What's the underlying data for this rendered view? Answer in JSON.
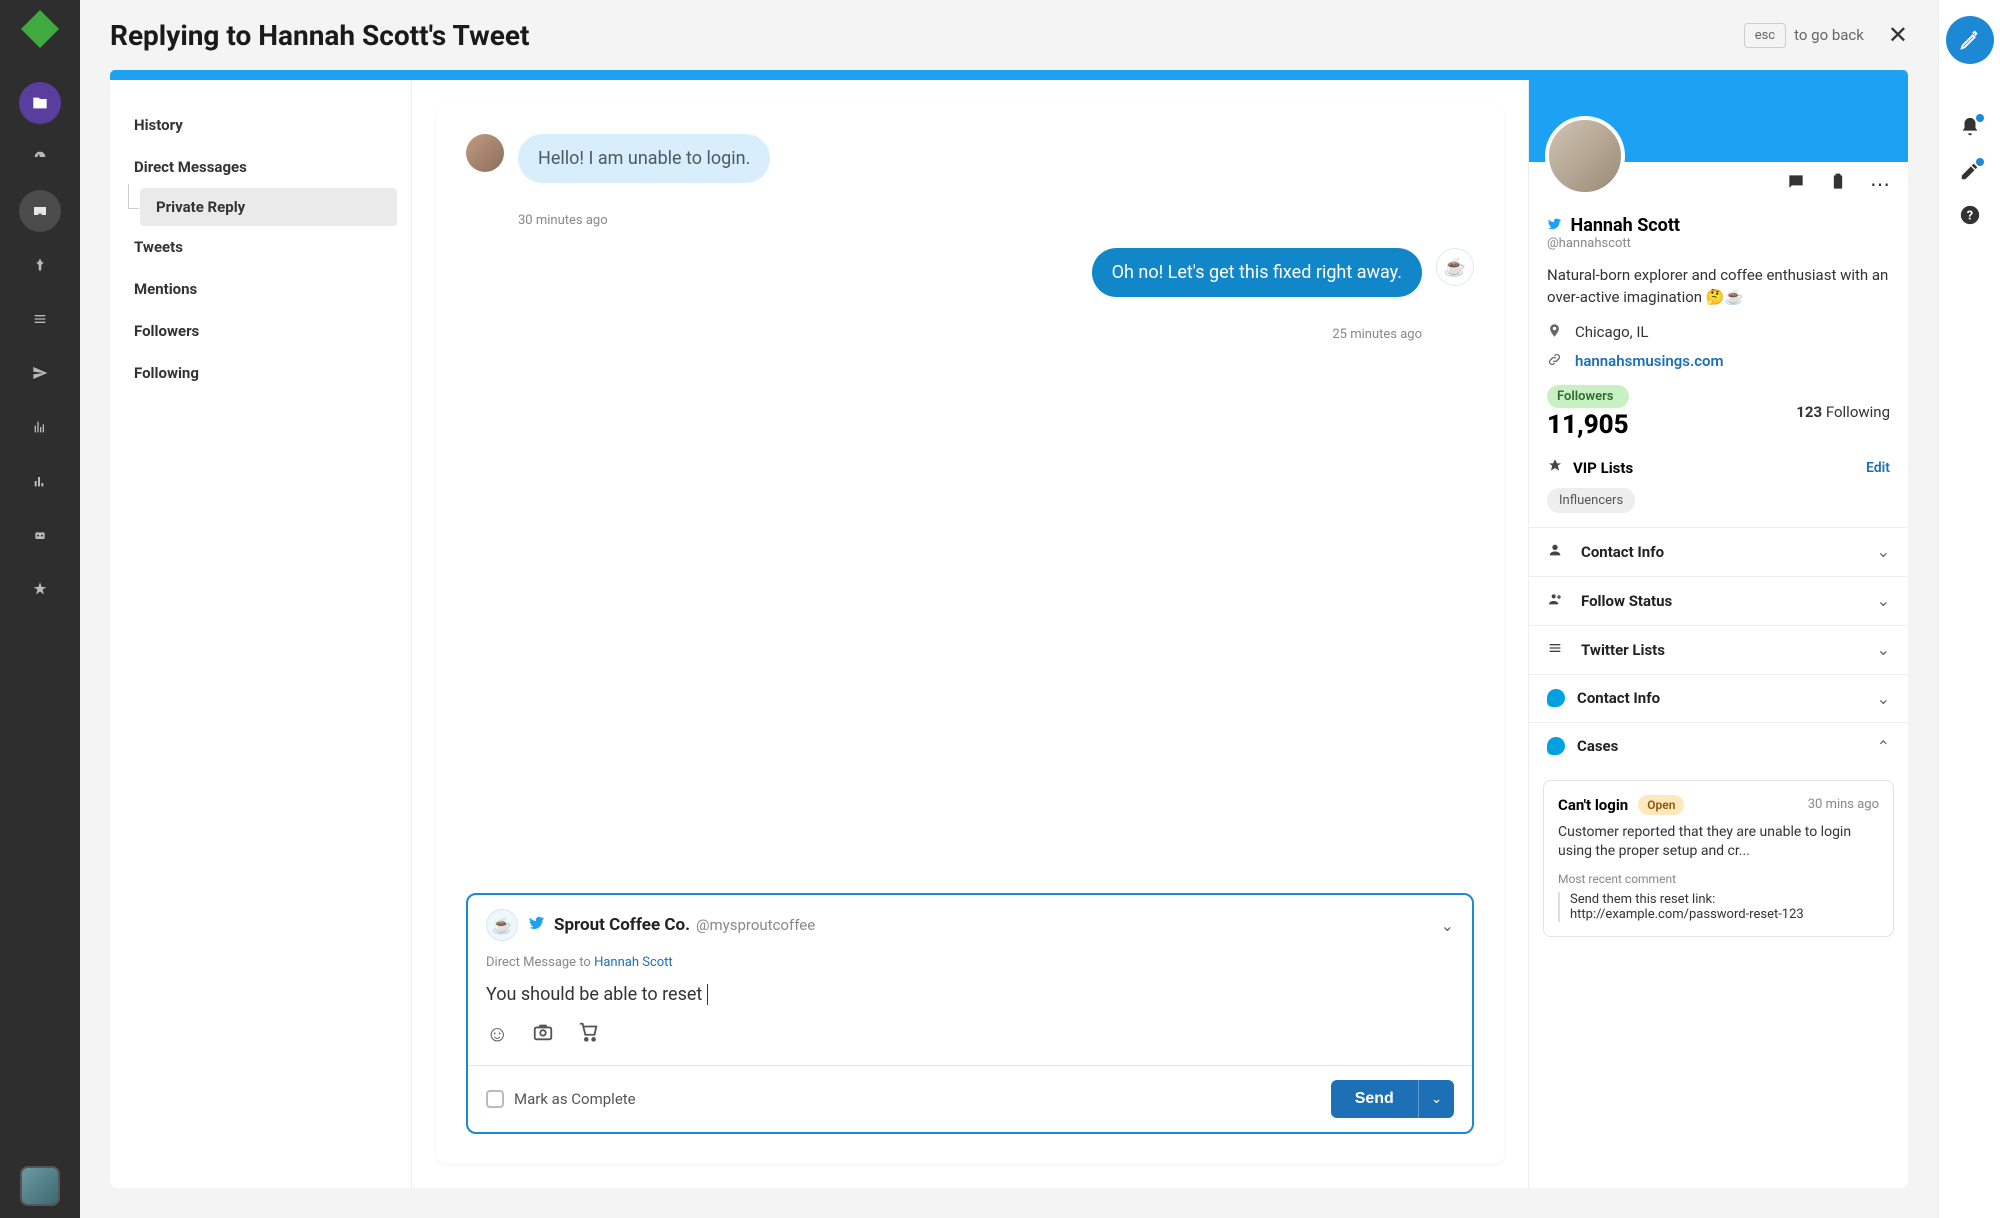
{
  "header": {
    "title": "Replying to Hannah Scott's Tweet",
    "esc_label": "esc",
    "go_back": "to go back"
  },
  "left_nav": {
    "items": [
      "History",
      "Direct Messages",
      "Tweets",
      "Mentions",
      "Followers",
      "Following"
    ],
    "sub_item": "Private Reply"
  },
  "chat": {
    "incoming": {
      "text": "Hello! I am unable to login.",
      "time": "30 minutes ago"
    },
    "outgoing": {
      "text": "Oh no! Let's get this fixed right away.",
      "time": "25 minutes ago"
    }
  },
  "compose": {
    "account_name": "Sprout Coffee Co.",
    "account_handle": "@mysproutcoffee",
    "dm_prefix": "Direct Message to ",
    "dm_target": "Hannah Scott",
    "draft": "You should be able to reset",
    "mark_complete": "Mark as Complete",
    "send": "Send"
  },
  "profile": {
    "name": "Hannah Scott",
    "handle": "@hannahscott",
    "bio": "Natural-born explorer and coffee enthusiast with an over-active imagination 🤔☕",
    "location": "Chicago, IL",
    "website": "hannahsmusings.com",
    "followers_label": "Followers",
    "followers": "11,905",
    "following_count": "123",
    "following_label": "Following",
    "vip_title": "VIP Lists",
    "vip_edit": "Edit",
    "vip_tag": "Influencers",
    "sections": [
      "Contact Info",
      "Follow Status",
      "Twitter Lists",
      "Contact Info",
      "Cases"
    ]
  },
  "case": {
    "title": "Can't login",
    "status": "Open",
    "time": "30 mins ago",
    "desc": "Customer reported that they are unable to login using the proper setup and cr...",
    "recent_label": "Most recent comment",
    "comment": "Send them this reset link: http://example.com/password-reset-123"
  }
}
